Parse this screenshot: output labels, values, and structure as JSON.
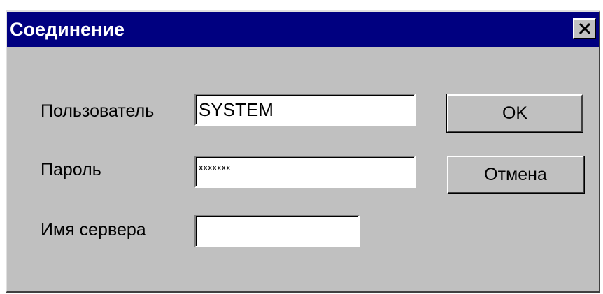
{
  "dialog": {
    "title": "Соединение",
    "close_glyph": "✕"
  },
  "form": {
    "user_label": "Пользователь",
    "user_value": "SYSTEM",
    "password_label": "Пароль",
    "password_value": "xxxxxxx",
    "server_label": "Имя сервера",
    "server_value": ""
  },
  "buttons": {
    "ok_label": "OK",
    "cancel_label": "Отмена"
  },
  "colors": {
    "titlebar": "#000080",
    "window_face": "#c0c0c0"
  },
  "icons": [
    "close-icon"
  ]
}
